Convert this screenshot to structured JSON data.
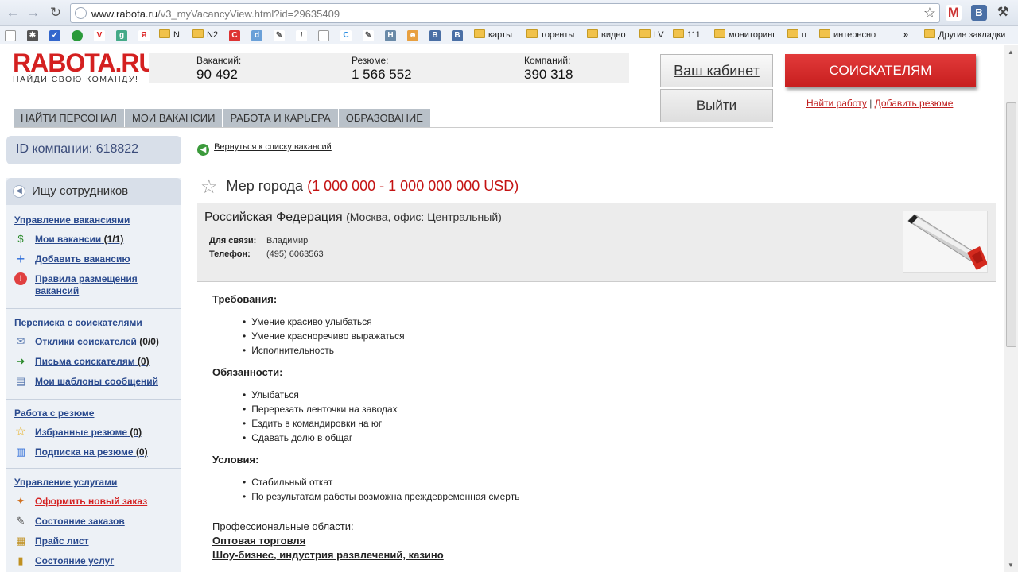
{
  "browser": {
    "url_main": "www.rabota.ru",
    "url_rest": "/v3_myVacancyView.html?id=29635409",
    "bookmarks": [
      "N",
      "N2",
      "карты",
      "торенты",
      "видео",
      "LV",
      "111",
      "мониторинг",
      "п",
      "интересно"
    ],
    "other_bookmarks": "Другие закладки",
    "ext_icons": [
      "gmail-icon",
      "vk-icon",
      "wrench-icon"
    ]
  },
  "site": {
    "logo_text": "RABOTA.RU",
    "logo_tagline": "НАЙДИ СВОЮ КОМАНДУ!",
    "stats": [
      {
        "label": "Вакансий:",
        "value": "90 492"
      },
      {
        "label": "Резюме:",
        "value": "1 566 552"
      },
      {
        "label": "Компаний:",
        "value": "390 318"
      }
    ],
    "cabinet_label": "Ваш кабинет",
    "logout_label": "Выйти",
    "seekers_label": "СОИСКАТЕЛЯМ",
    "find_job": "Найти работу",
    "separator": "|",
    "add_resume": "Добавить резюме",
    "nav": [
      "НАЙТИ ПЕРСОНАЛ",
      "МОИ ВАКАНСИИ",
      "РАБОТА И КАРЬЕРА",
      "ОБРАЗОВАНИЕ"
    ]
  },
  "sidebar": {
    "company_id": "ID компании: 618822",
    "head": "Ищу сотрудников",
    "sections": [
      {
        "title": "Управление вакансиями",
        "items": [
          {
            "label": "Мои вакансии",
            "count": "(1/1)"
          },
          {
            "label": "Добавить вакансию",
            "count": ""
          },
          {
            "label": "Правила размещения вакансий",
            "count": ""
          }
        ]
      },
      {
        "title": "Переписка с соискателями",
        "items": [
          {
            "label": "Отклики соискателей",
            "count": "(0/0)"
          },
          {
            "label": "Письма соискателям",
            "count": "(0)"
          },
          {
            "label": "Мои шаблоны сообщений",
            "count": ""
          }
        ]
      },
      {
        "title": "Работа с резюме",
        "items": [
          {
            "label": "Избранные резюме",
            "count": "(0)"
          },
          {
            "label": "Подписка на резюме",
            "count": "(0)"
          }
        ]
      },
      {
        "title": "Управление услугами",
        "items": [
          {
            "label": "Оформить новый заказ",
            "count": ""
          },
          {
            "label": "Состояние заказов",
            "count": ""
          },
          {
            "label": "Прайс лист",
            "count": ""
          },
          {
            "label": "Состояние услуг",
            "count": ""
          }
        ]
      }
    ]
  },
  "vacancy": {
    "back_link": "Вернуться к списку вакансий",
    "title": "Мер города",
    "salary": "(1 000 000 - 1 000 000 000 USD)",
    "employer": "Российская Федерация",
    "location": "(Москва, офис: Центральный)",
    "contact_label": "Для связи:",
    "contact_value": "Владимир",
    "phone_label": "Телефон:",
    "phone_value": "(495) 6063563",
    "requirements_title": "Требования:",
    "requirements": [
      "Умение красиво улыбаться",
      "Умение красноречиво выражаться",
      "Исполнительность"
    ],
    "duties_title": "Обязанности:",
    "duties": [
      "Улыбаться",
      "Перерезать ленточки на заводах",
      "Ездить в командировки на юг",
      "Сдавать долю в общаг"
    ],
    "conditions_title": "Условия:",
    "conditions": [
      "Стабильный откат",
      "По результатам работы возможна преждевременная смерть"
    ],
    "prof_title": "Профессиональные области:",
    "prof_areas": [
      "Оптовая торговля",
      "Шоу-бизнес, индустрия развлечений, казино"
    ]
  }
}
